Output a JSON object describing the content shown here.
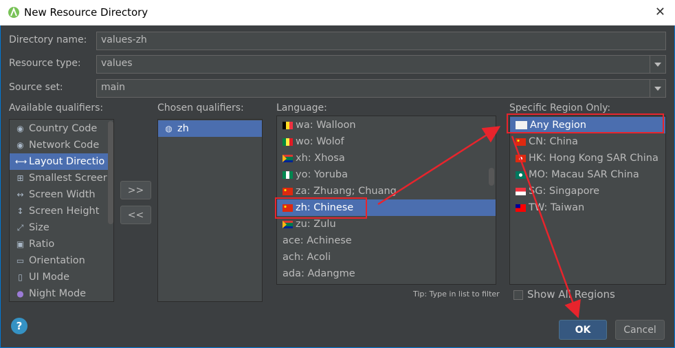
{
  "window": {
    "title": "New Resource Directory"
  },
  "form": {
    "directory_name_label": "Directory name:",
    "directory_name_value": "values-zh",
    "resource_type_label": "Resource type:",
    "resource_type_value": "values",
    "source_set_label": "Source set:",
    "source_set_value": "main"
  },
  "available": {
    "label": "Available qualifiers:",
    "items": [
      {
        "label": "Country Code",
        "icon": "country-code-icon"
      },
      {
        "label": "Network Code",
        "icon": "network-code-icon"
      },
      {
        "label": "Layout Directio",
        "icon": "layout-direction-icon"
      },
      {
        "label": "Smallest Screer",
        "icon": "smallest-screen-icon"
      },
      {
        "label": "Screen Width",
        "icon": "screen-width-icon"
      },
      {
        "label": "Screen Height",
        "icon": "screen-height-icon"
      },
      {
        "label": "Size",
        "icon": "size-icon"
      },
      {
        "label": "Ratio",
        "icon": "ratio-icon"
      },
      {
        "label": "Orientation",
        "icon": "orientation-icon"
      },
      {
        "label": "UI Mode",
        "icon": "ui-mode-icon"
      },
      {
        "label": "Night Mode",
        "icon": "night-mode-icon"
      }
    ],
    "selected_index": 2
  },
  "transfer": {
    "add_label": ">>",
    "remove_label": "<<"
  },
  "chosen": {
    "label": "Chosen qualifiers:",
    "items": [
      {
        "label": "zh",
        "icon": "globe-icon"
      }
    ]
  },
  "language": {
    "label": "Language:",
    "items": [
      {
        "label": "wa: Walloon"
      },
      {
        "label": "wo: Wolof"
      },
      {
        "label": "xh: Xhosa"
      },
      {
        "label": "yo: Yoruba"
      },
      {
        "label": "za: Zhuang; Chuang"
      },
      {
        "label": "zh: Chinese"
      },
      {
        "label": "zu: Zulu"
      },
      {
        "label": "ace: Achinese"
      },
      {
        "label": "ach: Acoli"
      },
      {
        "label": "ada: Adangme"
      }
    ],
    "selected_index": 5,
    "tip": "Tip: Type in list to filter"
  },
  "region": {
    "label": "Specific Region Only:",
    "items": [
      {
        "label": "Any Region"
      },
      {
        "label": "CN: China"
      },
      {
        "label": "HK: Hong Kong SAR China"
      },
      {
        "label": "MO: Macau SAR China"
      },
      {
        "label": "SG: Singapore"
      },
      {
        "label": "TW: Taiwan"
      }
    ],
    "selected_index": 0,
    "show_all_label": "Show All Regions",
    "show_all_checked": false
  },
  "buttons": {
    "ok": "OK",
    "cancel": "Cancel",
    "help": "?"
  },
  "colors": {
    "background": "#3c3f41",
    "selection": "#4b6eaf",
    "annotation": "#e8242c",
    "ok_button": "#365880"
  }
}
